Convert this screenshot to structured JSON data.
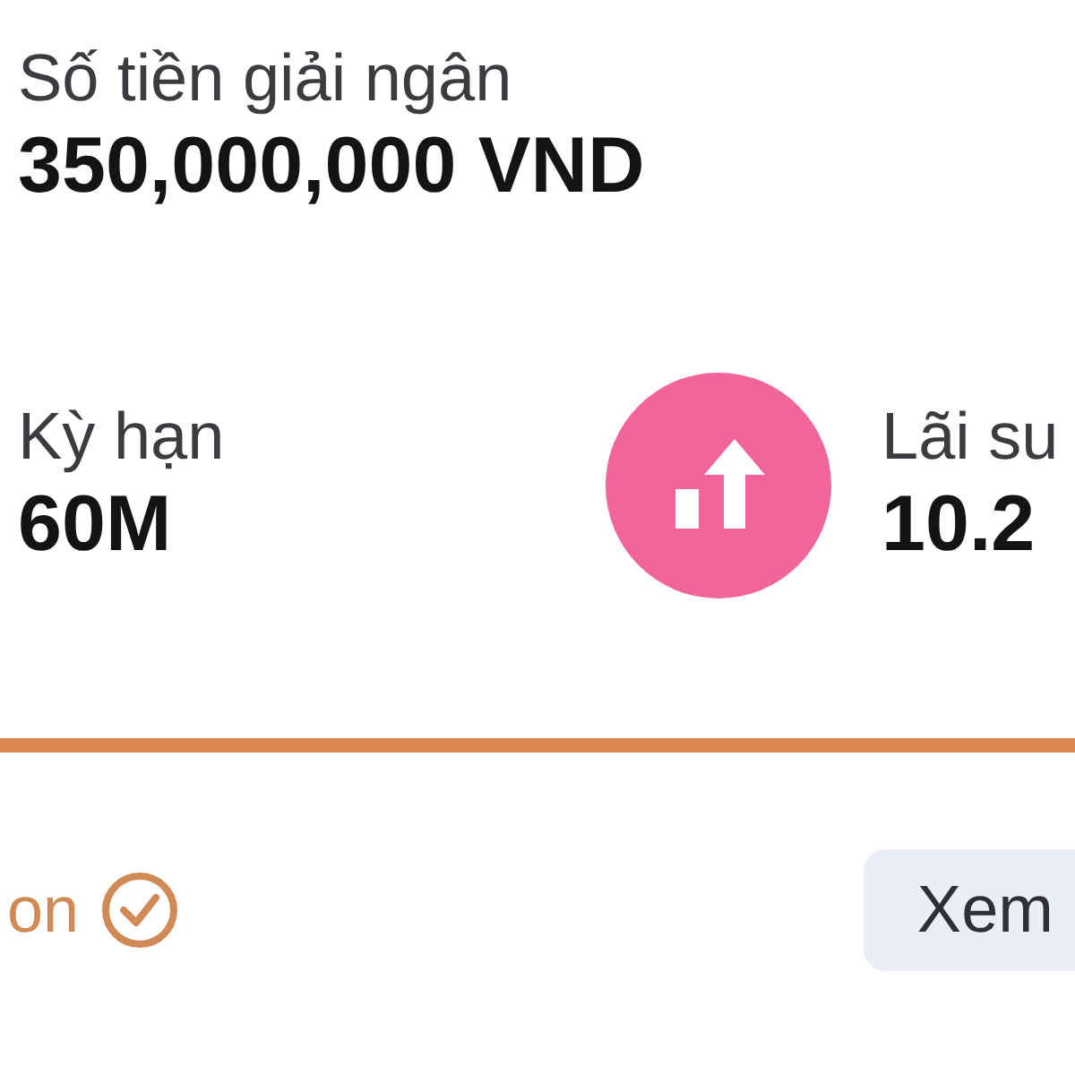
{
  "disbursement": {
    "label": "Số tiền giải ngân",
    "value": "350,000,000 VND"
  },
  "term": {
    "label": "Kỳ hạn",
    "value": "60M"
  },
  "interest": {
    "label": "Lãi su",
    "value": "10.2"
  },
  "status": {
    "text": "on",
    "verified": true
  },
  "buttons": [
    "Xem"
  ]
}
